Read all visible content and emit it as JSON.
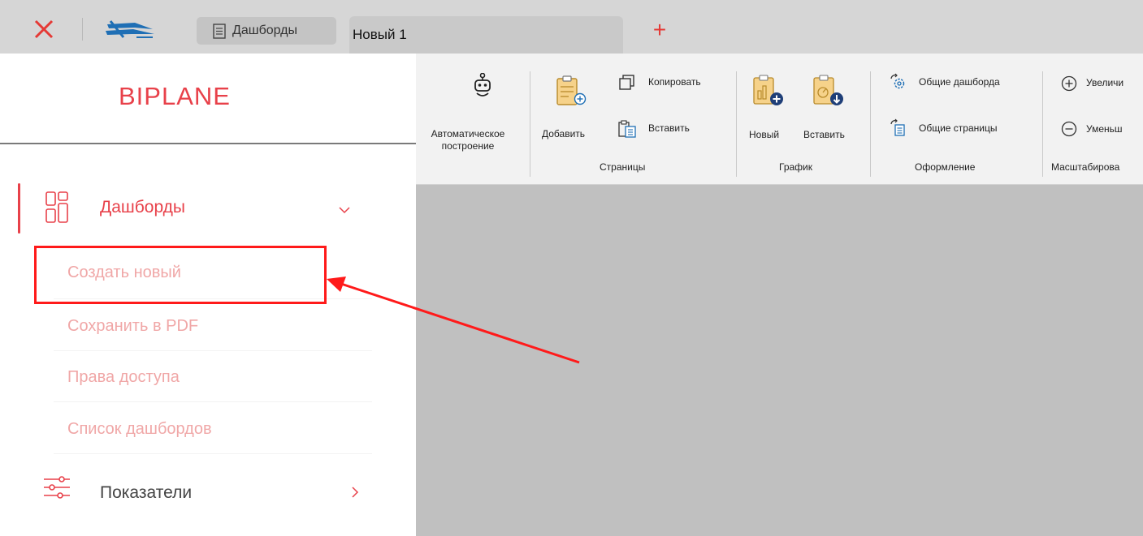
{
  "tabbar": {
    "dashboards_tab": "Дашборды",
    "document_tab": "Новый 1",
    "add_tab": "+"
  },
  "ribbon": {
    "auto_build": "Автоматическое построение",
    "pages": {
      "add": "Добавить",
      "copy": "Копировать",
      "paste": "Вставить",
      "group": "Страницы"
    },
    "chart": {
      "new": "Новый",
      "paste": "Вставить",
      "group": "График"
    },
    "design": {
      "shared_dashboards": "Общие дашборда",
      "shared_pages": "Общие страницы",
      "group": "Оформление"
    },
    "zoom": {
      "increase": "Увеличи",
      "decrease": "Уменьш",
      "group": "Масштабирова"
    }
  },
  "sidebar": {
    "brand": "BIPLANE",
    "dashboards": {
      "label": "Дашборды",
      "items": [
        "Создать новый",
        "Сохранить в PDF",
        "Права доступа",
        "Список дашбордов"
      ]
    },
    "indicators": {
      "label": "Показатели"
    }
  },
  "colors": {
    "brand": "#e8414a",
    "annotation": "#ff1a1a",
    "tab_add": "#e53935"
  },
  "icons": [
    "close-icon",
    "biplane-logo-icon",
    "document-icon",
    "robot-icon",
    "add-page-icon",
    "copy-icon",
    "paste-icon",
    "new-chart-icon",
    "paste-chart-icon",
    "shared-dashboards-icon",
    "shared-pages-icon",
    "zoom-in-icon",
    "zoom-out-icon",
    "dashboards-grid-icon",
    "chevron-down-icon",
    "sliders-icon",
    "chevron-right-icon"
  ]
}
